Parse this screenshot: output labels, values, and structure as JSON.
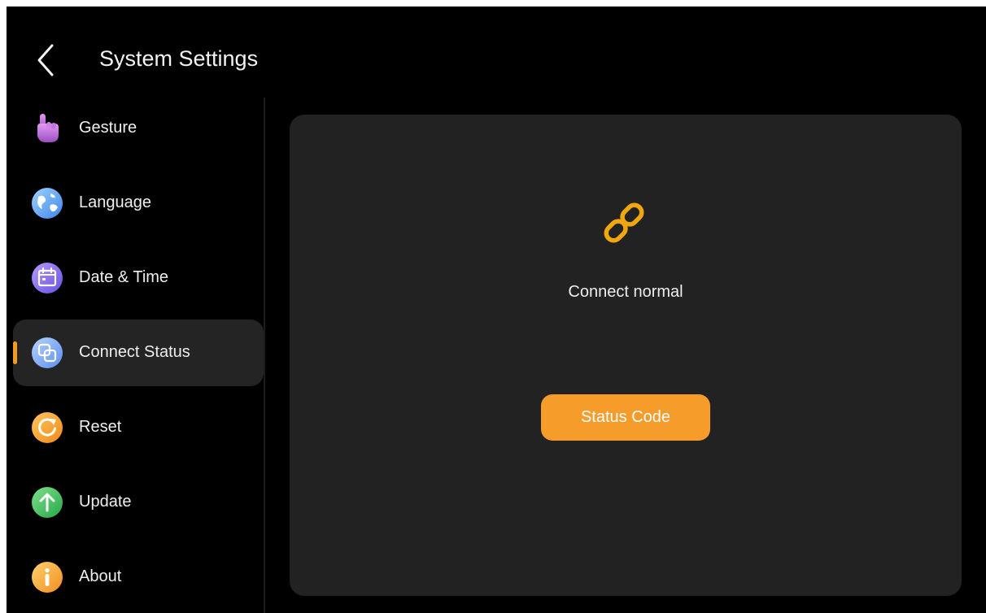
{
  "header": {
    "title": "System Settings",
    "back_icon": "chevron-left-icon"
  },
  "sidebar": {
    "items": [
      {
        "label": "Gesture",
        "icon": "hand-pointer-icon",
        "icon_color": "#c77de0",
        "active": false
      },
      {
        "label": "Language",
        "icon": "globe-icon",
        "icon_color": "#5aa8f0",
        "active": false
      },
      {
        "label": "Date & Time",
        "icon": "calendar-icon",
        "icon_color": "#8b6cf2",
        "active": false
      },
      {
        "label": "Connect Status",
        "icon": "connect-icon",
        "icon_color": "#6a9ff5",
        "active": true
      },
      {
        "label": "Reset",
        "icon": "reset-icon",
        "icon_color": "#f5a623",
        "active": false
      },
      {
        "label": "Update",
        "icon": "arrow-up-icon",
        "icon_color": "#3dbb5a",
        "active": false
      },
      {
        "label": "About",
        "icon": "info-icon",
        "icon_color": "#f5a623",
        "active": false
      }
    ]
  },
  "main": {
    "status_icon": "link-icon",
    "status_text": "Connect normal",
    "button_label": "Status Code"
  },
  "colors": {
    "background": "#000000",
    "panel": "#222222",
    "accent": "#f59c2b",
    "active_item": "#242424"
  }
}
